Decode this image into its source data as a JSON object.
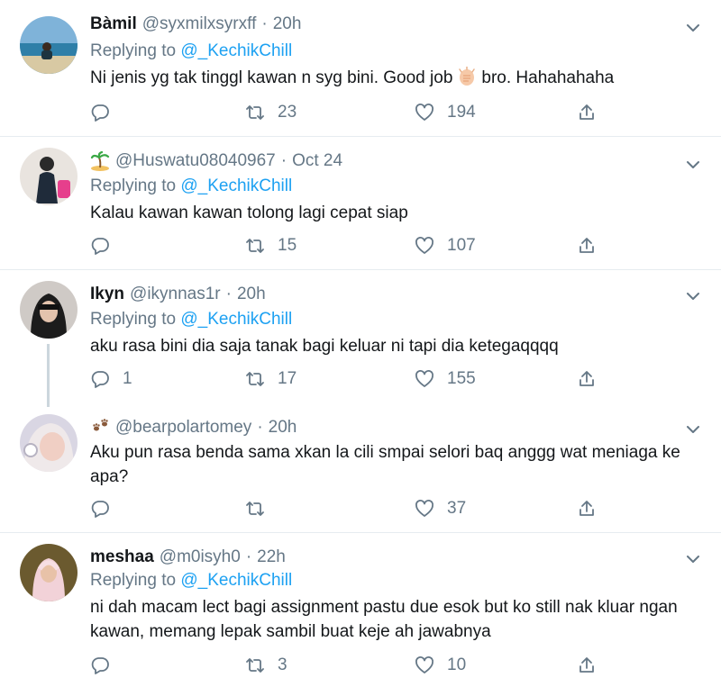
{
  "tweets": [
    {
      "name": "Bàmil",
      "handle": "@syxmilxsyrxff",
      "time": "20h",
      "replying_prefix": "Replying to",
      "replying_to": "@_KechikChill",
      "text_before": "Ni jenis yg tak tinggl kawan n syg bini. Good job",
      "text_after": "bro. Hahahahaha",
      "replies": "",
      "retweets": "23",
      "likes": "194"
    },
    {
      "name": "",
      "handle": "@Huswatu08040967",
      "time": "Oct 24",
      "replying_prefix": "Replying to",
      "replying_to": "@_KechikChill",
      "text": "Kalau kawan kawan tolong lagi cepat siap",
      "replies": "",
      "retweets": "15",
      "likes": "107"
    },
    {
      "name": "Ikyn",
      "handle": "@ikynnas1r",
      "time": "20h",
      "replying_prefix": "Replying to",
      "replying_to": "@_KechikChill",
      "text": "aku rasa bini dia saja tanak bagi keluar ni tapi dia ketegaqqqq",
      "replies": "1",
      "retweets": "17",
      "likes": "155"
    },
    {
      "name": "",
      "handle": "@bearpolartomey",
      "time": "20h",
      "text": "Aku pun rasa benda sama xkan la cili smpai selori baq anggg wat meniaga ke apa?",
      "replies": "",
      "retweets": "",
      "likes": "37"
    },
    {
      "name": "meshaa",
      "handle": "@m0isyh0",
      "time": "22h",
      "replying_prefix": "Replying to",
      "replying_to": "@_KechikChill",
      "text": "ni dah macam lect bagi assignment pastu due esok but ko still nak kluar ngan kawan, memang lepak sambil buat keje ah jawabnya",
      "replies": "",
      "retweets": "3",
      "likes": "10"
    }
  ],
  "icons": {
    "reply": "reply-icon",
    "retweet": "retweet-icon",
    "like": "heart-icon",
    "share": "share-icon",
    "more": "chevron-down-icon"
  },
  "colors": {
    "link": "#1da1f2",
    "muted": "#657786",
    "text": "#14171a",
    "border": "#e6ecf0"
  }
}
